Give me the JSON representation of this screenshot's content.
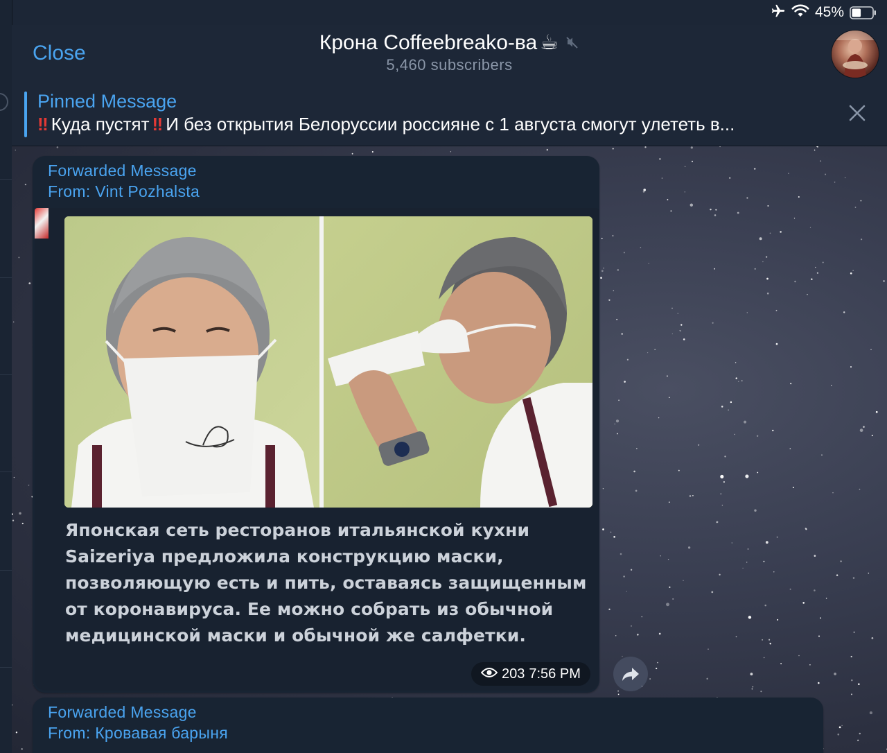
{
  "status_bar": {
    "battery_percent": "45%",
    "battery_level": 0.45,
    "icons": [
      "airplane-icon",
      "wifi-icon",
      "battery-icon"
    ]
  },
  "header": {
    "close_label": "Close",
    "channel_name": "Крона Coffeebreako-ва",
    "channel_emoji": "☕",
    "subscribers": "5,460 subscribers",
    "muted": true
  },
  "pinned": {
    "label": "Pinned Message",
    "bang_1": "‼",
    "lead": "Куда пустят",
    "bang_2": "‼",
    "text": "И без открытия Белоруссии россияне с 1 августа смогут улететь в..."
  },
  "messages": [
    {
      "forwarded_label": "Forwarded Message",
      "from": "From: Vint Pozhalsta",
      "caption": "Японская сеть ресторанов итальянской кухни Saizeriya предложила конструкцию маски, позволяющую есть и пить, оставаясь защищенным от коронавируса. Ее можно собрать из обычной медицинской маски и обычной же салфетки.",
      "views": "203",
      "time": "7:56 PM"
    },
    {
      "forwarded_label": "Forwarded Message",
      "from": "From: Кровавая барыня"
    }
  ],
  "colors": {
    "accent": "#4aa4f0",
    "header_bg": "#1d2737",
    "bubble_bg": "#182433",
    "alert_red": "#e53935"
  }
}
